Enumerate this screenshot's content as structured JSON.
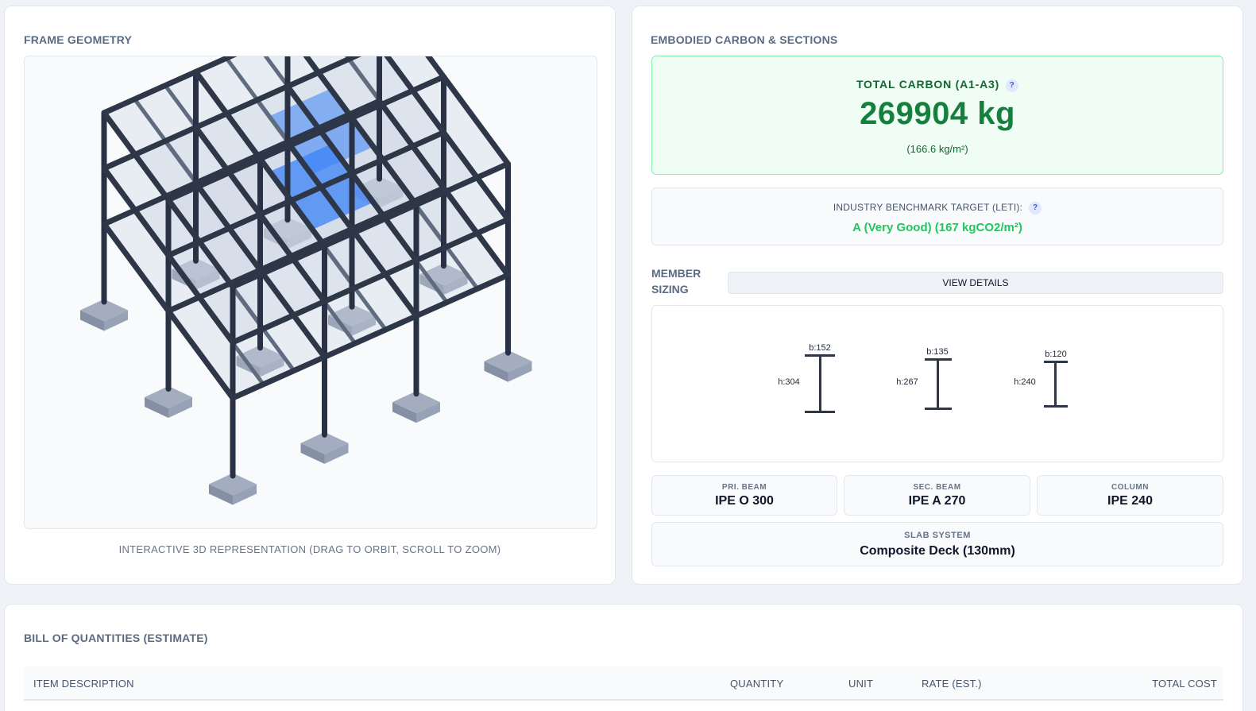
{
  "frame_geometry": {
    "title": "FRAME GEOMETRY",
    "caption": "INTERACTIVE 3D REPRESENTATION (DRAG TO ORBIT, SCROLL TO ZOOM)"
  },
  "carbon": {
    "title": "EMBODIED CARBON & SECTIONS",
    "total_label": "TOTAL CARBON (A1-A3)",
    "help_glyph": "?",
    "total_value": "269904 kg",
    "total_intensity": "(166.6 kg/m²)",
    "benchmark_label": "INDUSTRY BENCHMARK TARGET (LETI):",
    "benchmark_value": "A (Very Good) (167 kgCO2/m²)",
    "colors": {
      "good": "#22c55e",
      "total": "#15803d"
    }
  },
  "member_sizing": {
    "label": "MEMBER SIZING",
    "view_details_label": "VIEW DETAILS",
    "sections": [
      {
        "b_label": "b:152",
        "h_label": "h:304"
      },
      {
        "b_label": "b:135",
        "h_label": "h:267"
      },
      {
        "b_label": "b:120",
        "h_label": "h:240"
      }
    ],
    "tiles": [
      {
        "label": "PRI. BEAM",
        "value": "IPE O 300"
      },
      {
        "label": "SEC. BEAM",
        "value": "IPE A 270"
      },
      {
        "label": "COLUMN",
        "value": "IPE 240"
      }
    ],
    "slab": {
      "label": "SLAB SYSTEM",
      "value": "Composite Deck (130mm)"
    }
  },
  "boq": {
    "title": "BILL OF QUANTITIES (ESTIMATE)",
    "columns": [
      "ITEM DESCRIPTION",
      "QUANTITY",
      "UNIT",
      "RATE (EST.)",
      "TOTAL COST"
    ]
  }
}
